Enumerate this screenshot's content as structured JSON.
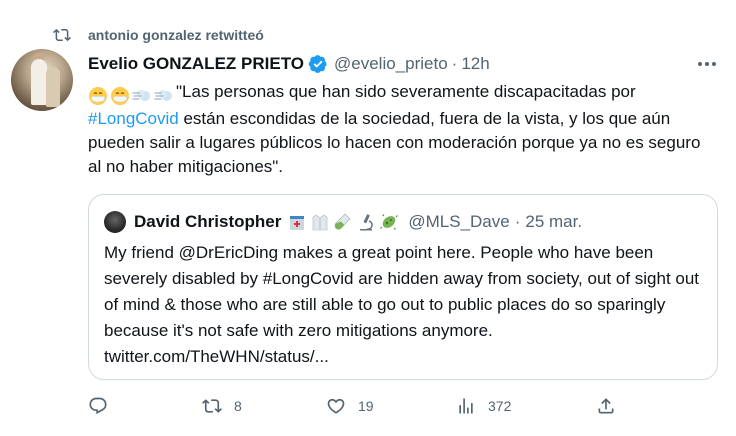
{
  "retweet": {
    "label": "antonio gonzalez retwitteó",
    "icon": "retweet-icon"
  },
  "tweet": {
    "author_name": "Evelio GONZALEZ PRIETO",
    "author_handle": "@evelio_prieto",
    "separator": "·",
    "time": "12h",
    "emojis": [
      "face-with-mask-emoji",
      "face-with-mask-emoji",
      "dash-emoji",
      "dash-emoji"
    ],
    "text_before_hashtag": "\"Las personas que han sido severamente discapacitadas por",
    "hashtag": "#LongCovid",
    "text_after_hashtag": " están escondidas de la sociedad, fuera de la vista, y los que aún pueden salir a lugares públicos lo hacen con moderación porque ya no es seguro al no haber mitigaciones\"."
  },
  "quote": {
    "author_name": "David Christopher",
    "emojis": [
      "hospital-emoji",
      "lab-coat-emoji",
      "test-tube-emoji",
      "microscope-emoji",
      "microbe-emoji"
    ],
    "author_handle": "@MLS_Dave",
    "separator": "·",
    "time": "25 mar.",
    "text": "My friend @DrEricDing makes a great point here. People who have been severely disabled by #LongCovid are hidden away from society, out of sight out of mind & those who are still able to go out to public places do so sparingly because it's not safe with zero mitigations anymore. twitter.com/TheWHN/status/..."
  },
  "actions": {
    "reply_count": "",
    "retweet_count": "8",
    "like_count": "19",
    "views_count": "372"
  },
  "colors": {
    "accent": "#1d9bf0",
    "muted": "#536471",
    "text": "#0f1419",
    "border": "#cfd9de"
  }
}
